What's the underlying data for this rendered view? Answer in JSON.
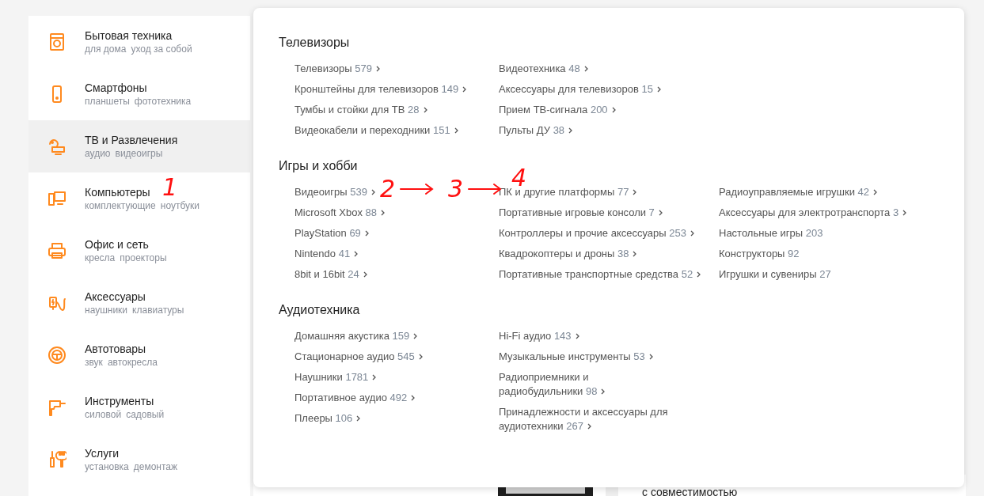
{
  "sidebar": {
    "items": [
      {
        "title": "Бытовая техника",
        "tags": [
          "для дома",
          "уход за собой"
        ],
        "selected": false
      },
      {
        "title": "Смартфоны",
        "tags": [
          "планшеты",
          "фототехника"
        ],
        "selected": false
      },
      {
        "title": "ТВ и Развлечения",
        "tags": [
          "аудио",
          "видеоигры"
        ],
        "selected": true
      },
      {
        "title": "Компьютеры",
        "tags": [
          "комплектующие",
          "ноутбуки"
        ],
        "selected": false
      },
      {
        "title": "Офис и сеть",
        "tags": [
          "кресла",
          "проекторы"
        ],
        "selected": false
      },
      {
        "title": "Аксессуары",
        "tags": [
          "наушники",
          "клавиатуры"
        ],
        "selected": false
      },
      {
        "title": "Автотовары",
        "tags": [
          "звук",
          "автокресла"
        ],
        "selected": false
      },
      {
        "title": "Инструменты",
        "tags": [
          "силовой",
          "садовый"
        ],
        "selected": false
      },
      {
        "title": "Услуги",
        "tags": [
          "установка",
          "демонтаж"
        ],
        "selected": false
      }
    ]
  },
  "menu": {
    "sections": [
      {
        "title": "Телевизоры",
        "columns": [
          [
            {
              "name": "Телевизоры",
              "count": "579",
              "expandable": true
            },
            {
              "name": "Кронштейны для телевизоров",
              "count": "149",
              "expandable": true
            },
            {
              "name": "Тумбы и стойки для ТВ",
              "count": "28",
              "expandable": true
            },
            {
              "name": "Видеокабели и переходники",
              "count": "151",
              "expandable": true
            }
          ],
          [
            {
              "name": "Видеотехника",
              "count": "48",
              "expandable": true
            },
            {
              "name": "Аксессуары для телевизоров",
              "count": "15",
              "expandable": true
            },
            {
              "name": "Прием ТВ-сигнала",
              "count": "200",
              "expandable": true
            },
            {
              "name": "Пульты ДУ",
              "count": "38",
              "expandable": true
            }
          ]
        ]
      },
      {
        "title": "Игры и хобби",
        "columns": [
          [
            {
              "name": "Видеоигры",
              "count": "539",
              "expandable": true
            },
            {
              "name": "Microsoft Xbox",
              "count": "88",
              "expandable": true
            },
            {
              "name": "PlayStation",
              "count": "69",
              "expandable": true
            },
            {
              "name": "Nintendo",
              "count": "41",
              "expandable": true
            },
            {
              "name": "8bit и 16bit",
              "count": "24",
              "expandable": true
            }
          ],
          [
            {
              "name": "ПК и другие платформы",
              "count": "77",
              "expandable": true
            },
            {
              "name": "Портативные игровые консоли",
              "count": "7",
              "expandable": true
            },
            {
              "name": "Контроллеры и прочие аксессуары",
              "count": "253",
              "expandable": true
            },
            {
              "name": "Квадрокоптеры и дроны",
              "count": "38",
              "expandable": true
            },
            {
              "name": "Портативные транспортные средства",
              "count": "52",
              "expandable": true
            }
          ],
          [
            {
              "name": "Радиоуправляемые игрушки",
              "count": "42",
              "expandable": true
            },
            {
              "name": "Аксессуары для электротранспорта",
              "count": "3",
              "expandable": true
            },
            {
              "name": "Настольные игры",
              "count": "203",
              "expandable": false
            },
            {
              "name": "Конструкторы",
              "count": "92",
              "expandable": false
            },
            {
              "name": "Игрушки и сувениры",
              "count": "27",
              "expandable": false
            }
          ]
        ]
      },
      {
        "title": "Аудиотехника",
        "columns": [
          [
            {
              "name": "Домашняя акустика",
              "count": "159",
              "expandable": true
            },
            {
              "name": "Стационарное аудио",
              "count": "545",
              "expandable": true
            },
            {
              "name": "Наушники",
              "count": "1781",
              "expandable": true
            },
            {
              "name": "Портативное аудио",
              "count": "492",
              "expandable": true
            },
            {
              "name": "Плееры",
              "count": "106",
              "expandable": true
            }
          ],
          [
            {
              "name": "Hi-Fi аудио",
              "count": "143",
              "expandable": true
            },
            {
              "name": "Музыкальные инструменты",
              "count": "53",
              "expandable": true
            },
            {
              "name": "Радиоприемники и радиобудильники",
              "count": "98",
              "expandable": true
            },
            {
              "name": "Принадлежности и аксессуары для аудиотехники",
              "count": "267",
              "expandable": true
            }
          ]
        ]
      }
    ]
  },
  "background": {
    "card_text": "с совместимостью"
  },
  "annotations": [
    "1",
    "2",
    "3",
    "4"
  ]
}
